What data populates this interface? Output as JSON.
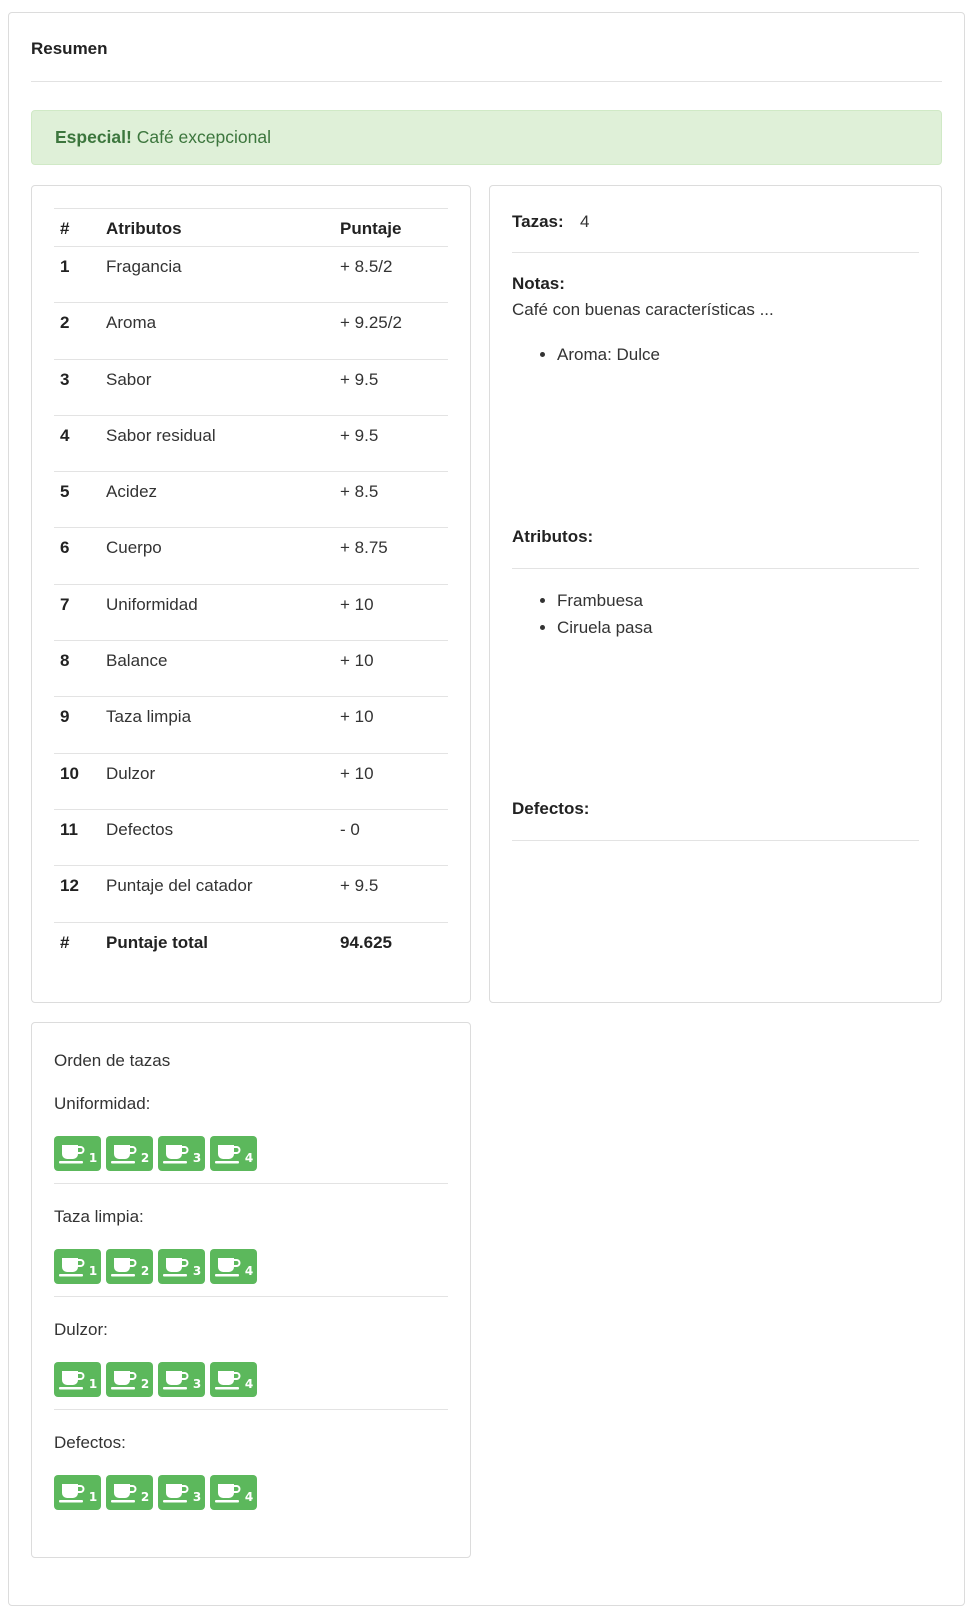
{
  "summary": {
    "title": "Resumen",
    "alert": {
      "strong": "Especial!",
      "text": "Café excepcional"
    }
  },
  "scores": {
    "headers": {
      "num": "#",
      "attribute": "Atributos",
      "score": "Puntaje"
    },
    "rows": [
      {
        "num": "1",
        "attribute": "Fragancia",
        "score": "+ 8.5/2"
      },
      {
        "num": "2",
        "attribute": "Aroma",
        "score": "+ 9.25/2"
      },
      {
        "num": "3",
        "attribute": "Sabor",
        "score": "+ 9.5"
      },
      {
        "num": "4",
        "attribute": "Sabor residual",
        "score": "+ 9.5"
      },
      {
        "num": "5",
        "attribute": "Acidez",
        "score": "+ 8.5"
      },
      {
        "num": "6",
        "attribute": "Cuerpo",
        "score": "+ 8.75"
      },
      {
        "num": "7",
        "attribute": "Uniformidad",
        "score": "+ 10"
      },
      {
        "num": "8",
        "attribute": "Balance",
        "score": "+ 10"
      },
      {
        "num": "9",
        "attribute": "Taza limpia",
        "score": "+ 10"
      },
      {
        "num": "10",
        "attribute": "Dulzor",
        "score": "+ 10"
      },
      {
        "num": "11",
        "attribute": "Defectos",
        "score": "- 0"
      },
      {
        "num": "12",
        "attribute": "Puntaje del catador",
        "score": "+ 9.5"
      }
    ],
    "total": {
      "num": "#",
      "label": "Puntaje total",
      "value": "94.625"
    }
  },
  "info": {
    "cups_label": "Tazas:",
    "cups_value": "4",
    "notes_label": "Notas:",
    "notes_text": "Café con buenas características ...",
    "notes_items": [
      "Aroma: Dulce"
    ],
    "attributes_label": "Atributos:",
    "attributes_items": [
      "Frambuesa",
      "Ciruela pasa"
    ],
    "defects_label": "Defectos:"
  },
  "cups_order": {
    "title": "Orden de tazas",
    "cup_color": "#5cb85c",
    "cup_icon": "coffee-cup-icon",
    "sections": [
      {
        "label": "Uniformidad:",
        "cups": [
          "1",
          "2",
          "3",
          "4"
        ]
      },
      {
        "label": "Taza limpia:",
        "cups": [
          "1",
          "2",
          "3",
          "4"
        ]
      },
      {
        "label": "Dulzor:",
        "cups": [
          "1",
          "2",
          "3",
          "4"
        ]
      },
      {
        "label": "Defectos:",
        "cups": [
          "1",
          "2",
          "3",
          "4"
        ]
      }
    ]
  }
}
